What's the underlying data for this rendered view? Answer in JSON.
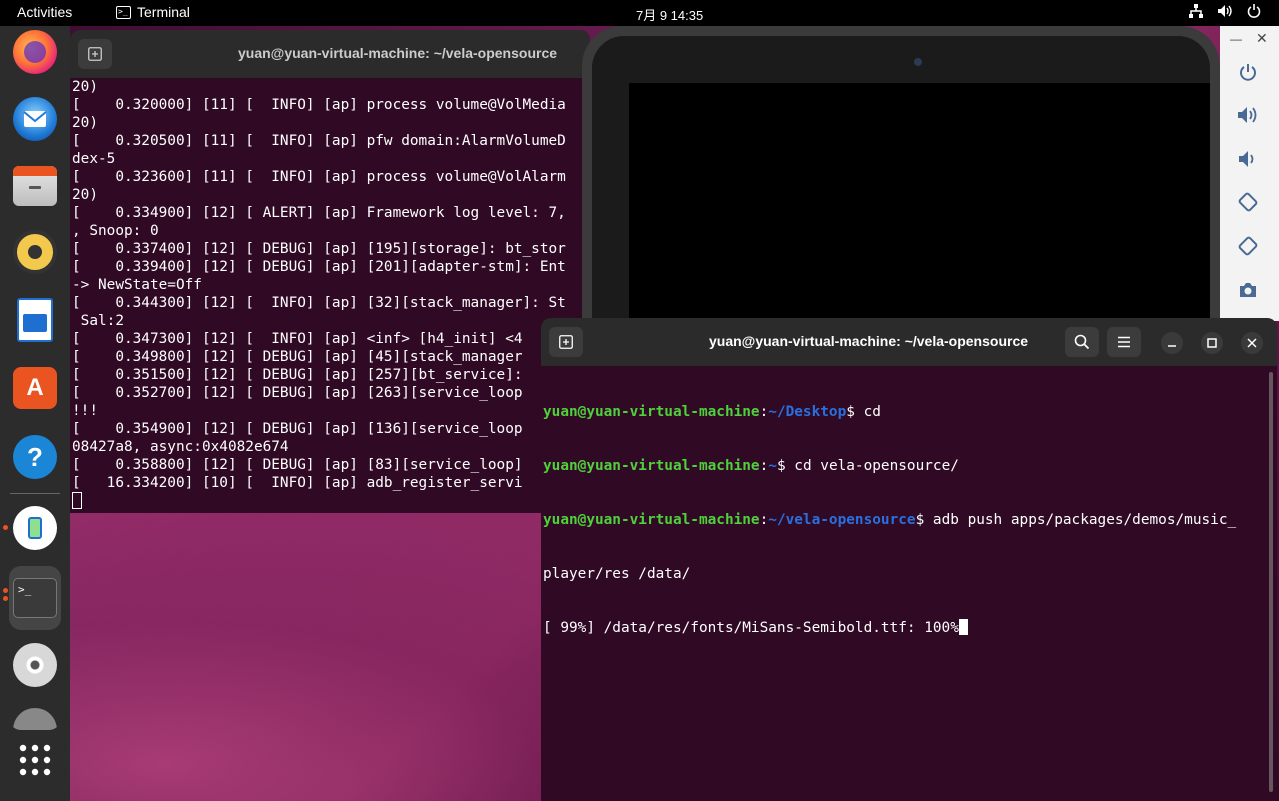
{
  "topbar": {
    "activities": "Activities",
    "app_name": "Terminal",
    "clock": "7月 9  14:35"
  },
  "dock": {
    "items": [
      "firefox-icon",
      "thunderbird-icon",
      "files-icon",
      "rhythmbox-icon",
      "libreoffice-writer-icon",
      "app-center-icon",
      "help-icon",
      "emulator-icon",
      "terminal-icon",
      "disc-icon",
      "show-apps-icon"
    ]
  },
  "window_back": {
    "title": "yuan@yuan-virtual-machine: ~/vela-opensource",
    "lines": [
      "20)",
      "[    0.320000] [11] [  INFO] [ap] process volume@VolMedia",
      "20)",
      "[    0.320500] [11] [  INFO] [ap] pfw domain:AlarmVolumeD",
      "dex-5",
      "[    0.323600] [11] [  INFO] [ap] process volume@VolAlarm",
      "20)",
      "[    0.334900] [12] [ ALERT] [ap] Framework log level: 7,",
      ", Snoop: 0",
      "[    0.337400] [12] [ DEBUG] [ap] [195][storage]: bt_stor",
      "[    0.339400] [12] [ DEBUG] [ap] [201][adapter-stm]: Ent",
      "-> NewState=Off",
      "[    0.344300] [12] [  INFO] [ap] [32][stack_manager]: St",
      " Sal:2",
      "[    0.347300] [12] [  INFO] [ap] <inf> [h4_init] <4",
      "[    0.349800] [12] [ DEBUG] [ap] [45][stack_manager",
      "[    0.351500] [12] [ DEBUG] [ap] [257][bt_service]:",
      "[    0.352700] [12] [ DEBUG] [ap] [263][service_loop",
      "!!!",
      "[    0.354900] [12] [ DEBUG] [ap] [136][service_loop",
      "08427a8, async:0x4082e674",
      "[    0.358800] [12] [ DEBUG] [ap] [83][service_loop]",
      "[   16.334200] [10] [  INFO] [ap] adb_register_servi"
    ]
  },
  "window_front": {
    "title": "yuan@yuan-virtual-machine: ~/vela-opensource",
    "prompt_user": "yuan@yuan-virtual-machine",
    "l1_path": "~/Desktop",
    "l1_cmd": " cd",
    "l2_path": "~",
    "l2_cmd": " cd vela-opensource/",
    "l3_path": "~/vela-opensource",
    "l3_cmd": " adb push apps/packages/demos/music_",
    "l4": "player/res /data/",
    "l5": "[ 99%] /data/res/fonts/MiSans-Semibold.ttf: 100%"
  }
}
